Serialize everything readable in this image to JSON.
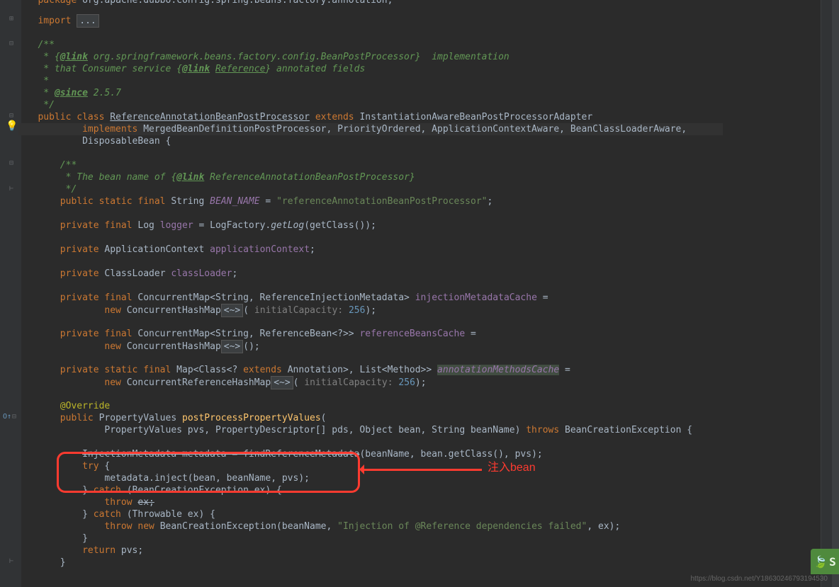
{
  "code": {
    "package_line": "package org.apache.dubbo.config.spring.beans.factory.annotation;",
    "import_kw": "import ",
    "import_fold": "...",
    "doc1": "/**",
    "doc2_pre": " * {",
    "doc2_link": "@link",
    "doc2_post": " org.springframework.beans.factory.config.BeanPostProcessor}  implementation",
    "doc3_pre": " * that Consumer service {",
    "doc3_link": "@link",
    "doc3_mid": " ",
    "doc3_ref": "Reference",
    "doc3_post": "} annotated fields",
    "doc4": " *",
    "doc5_pre": " * ",
    "doc5_since": "@since",
    "doc5_post": " 2.5.7",
    "doc6": " */",
    "class_line_public": "public",
    "class_line_class": " class ",
    "class_name": "ReferenceAnnotationBeanPostProcessor",
    "class_extends": " extends ",
    "class_parent": "InstantiationAwareBeanPostProcessorAdapter",
    "impl_kw": "implements ",
    "impl_list": "MergedBeanDefinitionPostProcessor, PriorityOrdered, ApplicationContextAware, BeanClassLoaderAware,",
    "impl_line2": "DisposableBean {",
    "doc_bean1": "/**",
    "doc_bean2_pre": " * The bean name of {",
    "doc_bean2_link": "@link",
    "doc_bean2_post": " ReferenceAnnotationBeanPostProcessor}",
    "doc_bean3": " */",
    "bean_mods": "public static final ",
    "bean_type": "String ",
    "bean_field": "BEAN_NAME",
    "bean_eq": " = ",
    "bean_val": "\"referenceAnnotationBeanPostProcessor\"",
    "semi": ";",
    "log_mods": "private final ",
    "log_type": "Log ",
    "log_field": "logger",
    "log_eq": " = LogFactory.",
    "log_method": "getLog",
    "log_args": "(getClass());",
    "appctx_mods": "private ",
    "appctx_type": "ApplicationContext ",
    "appctx_field": "applicationContext",
    "cl_mods": "private ",
    "cl_type": "ClassLoader ",
    "cl_field": "classLoader",
    "injcache_mods": "private final ",
    "injcache_type": "ConcurrentMap<String, ReferenceInjectionMetadata> ",
    "injcache_field": "injectionMetadataCache",
    "injcache_eq": " =",
    "injcache_new": "new ",
    "injcache_ctor": "ConcurrentHashMap",
    "injcache_diamond": "<~>",
    "injcache_open": "(",
    "injcache_param": " initialCapacity: ",
    "injcache_val": "256",
    "injcache_close": ");",
    "refbean_mods": "private final ",
    "refbean_type": "ConcurrentMap<String, ReferenceBean<?>> ",
    "refbean_field": "referenceBeansCache",
    "refbean_eq": " =",
    "refbean_new": "new ",
    "refbean_ctor": "ConcurrentHashMap",
    "refbean_diamond": "<~>",
    "refbean_args": "();",
    "amc_mods": "private static final ",
    "amc_type_pre": "Map<Class<? ",
    "amc_extends": "extends",
    "amc_type_post": " Annotation>, List<Method>> ",
    "amc_field": "annotationMethodsCache",
    "amc_eq": " =",
    "amc_new": "new ",
    "amc_ctor": "ConcurrentReferenceHashMap",
    "amc_diamond": "<~>",
    "amc_open": "(",
    "amc_param": " initialCapacity: ",
    "amc_val": "256",
    "amc_close": ");",
    "override": "@Override",
    "ppv_mods": "public ",
    "ppv_ret": "PropertyValues ",
    "ppv_name": "postProcessPropertyValues",
    "ppv_open": "(",
    "ppv_args": "PropertyValues pvs, PropertyDescriptor[] pds, Object bean, String beanName) ",
    "ppv_throws": "throws ",
    "ppv_exc": "BeanCreationException {",
    "meta_decl_pre": "InjectionMetadata metadata = ",
    "meta_method": "findReferenceMetadata",
    "meta_args": "(beanName, bean.getClass(), pvs);",
    "try_kw": "try",
    "try_brace": " {",
    "inject_call": "metadata.inject(bean, beanName, pvs);",
    "catch1_close": "} ",
    "catch1_kw": "catch",
    "catch1_args": " (BeanCreationException ex) {",
    "throw_ex": "throw ",
    "ex_var": "ex;",
    "catch2_close": "} ",
    "catch2_kw": "catch",
    "catch2_args": " (Throwable ex) {",
    "throw_new": "throw new ",
    "throw_ctor": "BeanCreationException(beanName, ",
    "throw_msg": "\"Injection of @Reference dependencies failed\"",
    "throw_end": ", ex);",
    "close_brace": "}",
    "return_kw": "return ",
    "return_var": "pvs;"
  },
  "annotation_label": "注入bean",
  "watermark": "https://blog.csdn.net/Y18630246793194530",
  "badge": "S"
}
